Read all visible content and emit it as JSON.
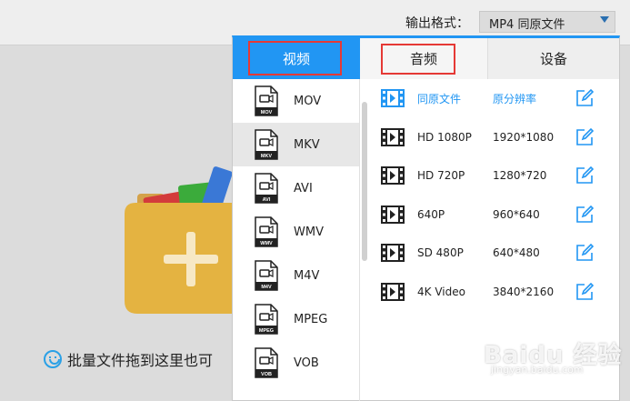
{
  "header": {
    "output_format_label": "输出格式：",
    "output_format_value": "MP4   同原文件"
  },
  "drop_area": {
    "hint": "批量文件拖到这里也可"
  },
  "panel": {
    "tabs": [
      {
        "label": "视频",
        "active": true
      },
      {
        "label": "音频",
        "active": false
      },
      {
        "label": "设备",
        "active": false
      }
    ],
    "formats": [
      {
        "name": "MOV",
        "icon_label": "MOV"
      },
      {
        "name": "MKV",
        "icon_label": "MKV",
        "selected": true
      },
      {
        "name": "AVI",
        "icon_label": "AVI"
      },
      {
        "name": "WMV",
        "icon_label": "WMV"
      },
      {
        "name": "M4V",
        "icon_label": "M4V"
      },
      {
        "name": "MPEG",
        "icon_label": "MPEG"
      },
      {
        "name": "VOB",
        "icon_label": "VOB"
      }
    ],
    "presets": [
      {
        "name": "同原文件",
        "resolution": "原分辨率"
      },
      {
        "name": "HD 1080P",
        "resolution": "1920*1080"
      },
      {
        "name": "HD 720P",
        "resolution": "1280*720"
      },
      {
        "name": "640P",
        "resolution": "960*640"
      },
      {
        "name": "SD 480P",
        "resolution": "640*480"
      },
      {
        "name": "4K Video",
        "resolution": "3840*2160"
      }
    ]
  },
  "watermark": {
    "main": "Baidu 经验",
    "sub": "jingyan.baidu.com"
  },
  "colors": {
    "accent": "#2196f3",
    "highlight_box": "#e53935",
    "folder": "#e4b341"
  }
}
